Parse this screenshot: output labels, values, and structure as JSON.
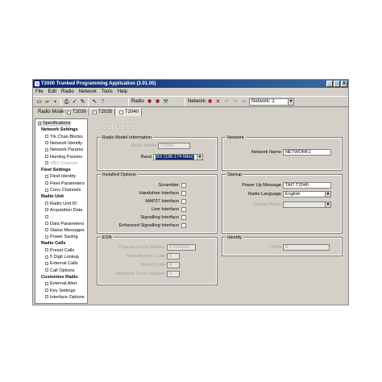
{
  "window": {
    "title": "T2000 Trunked Programming Application (3.01.00)",
    "min": "_",
    "max": "□",
    "close": "X"
  },
  "menu": [
    "File",
    "Edit",
    "Radio",
    "Network",
    "Tools",
    "Help"
  ],
  "toolbar": {
    "radio_label": "Radio",
    "network_label": "Network",
    "network_select": "Network: 1"
  },
  "models": {
    "label": "Radio Model",
    "tabs": [
      "T2030",
      "T2035",
      "T2040"
    ]
  },
  "tree": {
    "items": [
      {
        "label": "Specifications",
        "kind": "sel"
      },
      {
        "label": "Network Settings",
        "kind": "grp"
      },
      {
        "label": "Trk Chan Blocks",
        "kind": "item"
      },
      {
        "label": "Network Identity",
        "kind": "item"
      },
      {
        "label": "Network Params",
        "kind": "item"
      },
      {
        "label": "Hunting Params",
        "kind": "item"
      },
      {
        "label": "VBS Channel",
        "kind": "dis"
      },
      {
        "label": "Fleet Settings",
        "kind": "grp"
      },
      {
        "label": "Fleet Identity",
        "kind": "item"
      },
      {
        "label": "Fleet Parameters",
        "kind": "item"
      },
      {
        "label": "Conv Channels",
        "kind": "item"
      },
      {
        "label": "Radio Unit",
        "kind": "grp"
      },
      {
        "label": "Radio Unit ID",
        "kind": "item"
      },
      {
        "label": "Acquisition Data",
        "kind": "item"
      },
      {
        "label": "...",
        "kind": "dis"
      },
      {
        "label": "Data Parameters",
        "kind": "item"
      },
      {
        "label": "Status Messages",
        "kind": "item"
      },
      {
        "label": "Power Saving",
        "kind": "item"
      },
      {
        "label": "Radio Calls",
        "kind": "grp"
      },
      {
        "label": "Preset Calls",
        "kind": "item"
      },
      {
        "label": "5 Digit Lookup",
        "kind": "item"
      },
      {
        "label": "External Calls",
        "kind": "item"
      },
      {
        "label": "Call Options",
        "kind": "item"
      },
      {
        "label": "Customise Radio",
        "kind": "grp"
      },
      {
        "label": "External Alert",
        "kind": "item"
      },
      {
        "label": "Key Settings",
        "kind": "item"
      },
      {
        "label": "Interface Options",
        "kind": "item"
      }
    ]
  },
  "page": {
    "title": "Specifications",
    "radio_model_info": {
      "title": "Radio Model Information",
      "radio_model_label": "Radio Model",
      "radio_model_value": "T2040",
      "band_label": "Band",
      "band_value": "BX (136-174 MHz)"
    },
    "network": {
      "title": "Network",
      "name_label": "Network Name",
      "name_value": "NETWORK1"
    },
    "installed_options": {
      "title": "Installed Options",
      "items": [
        "Scrambler",
        "Handsfree Interface",
        "MAP27 Interface",
        "Line Interface",
        "Signalling Interface",
        "Enhanced Signalling Interface"
      ]
    },
    "startup": {
      "title": "Startup",
      "powerup_label": "Power Up Message",
      "powerup_value": "TAIT T2040",
      "language_label": "Radio Language",
      "language_value": "English",
      "display_label": "Display Driver",
      "display_value": ""
    },
    "esn": {
      "title": "ESN",
      "chassis_label": "Chassis Serial Number",
      "chassis_value": "17000000",
      "mfr_label": "Manufacturer Code",
      "mfr_value": "0",
      "model_label": "Model Code",
      "model_value": "0",
      "electronic_label": "Electronic Serial Number",
      "electronic_value": "0"
    },
    "identity": {
      "title": "Identity",
      "cesn_label": "CESN",
      "cesn_value": "0"
    }
  }
}
